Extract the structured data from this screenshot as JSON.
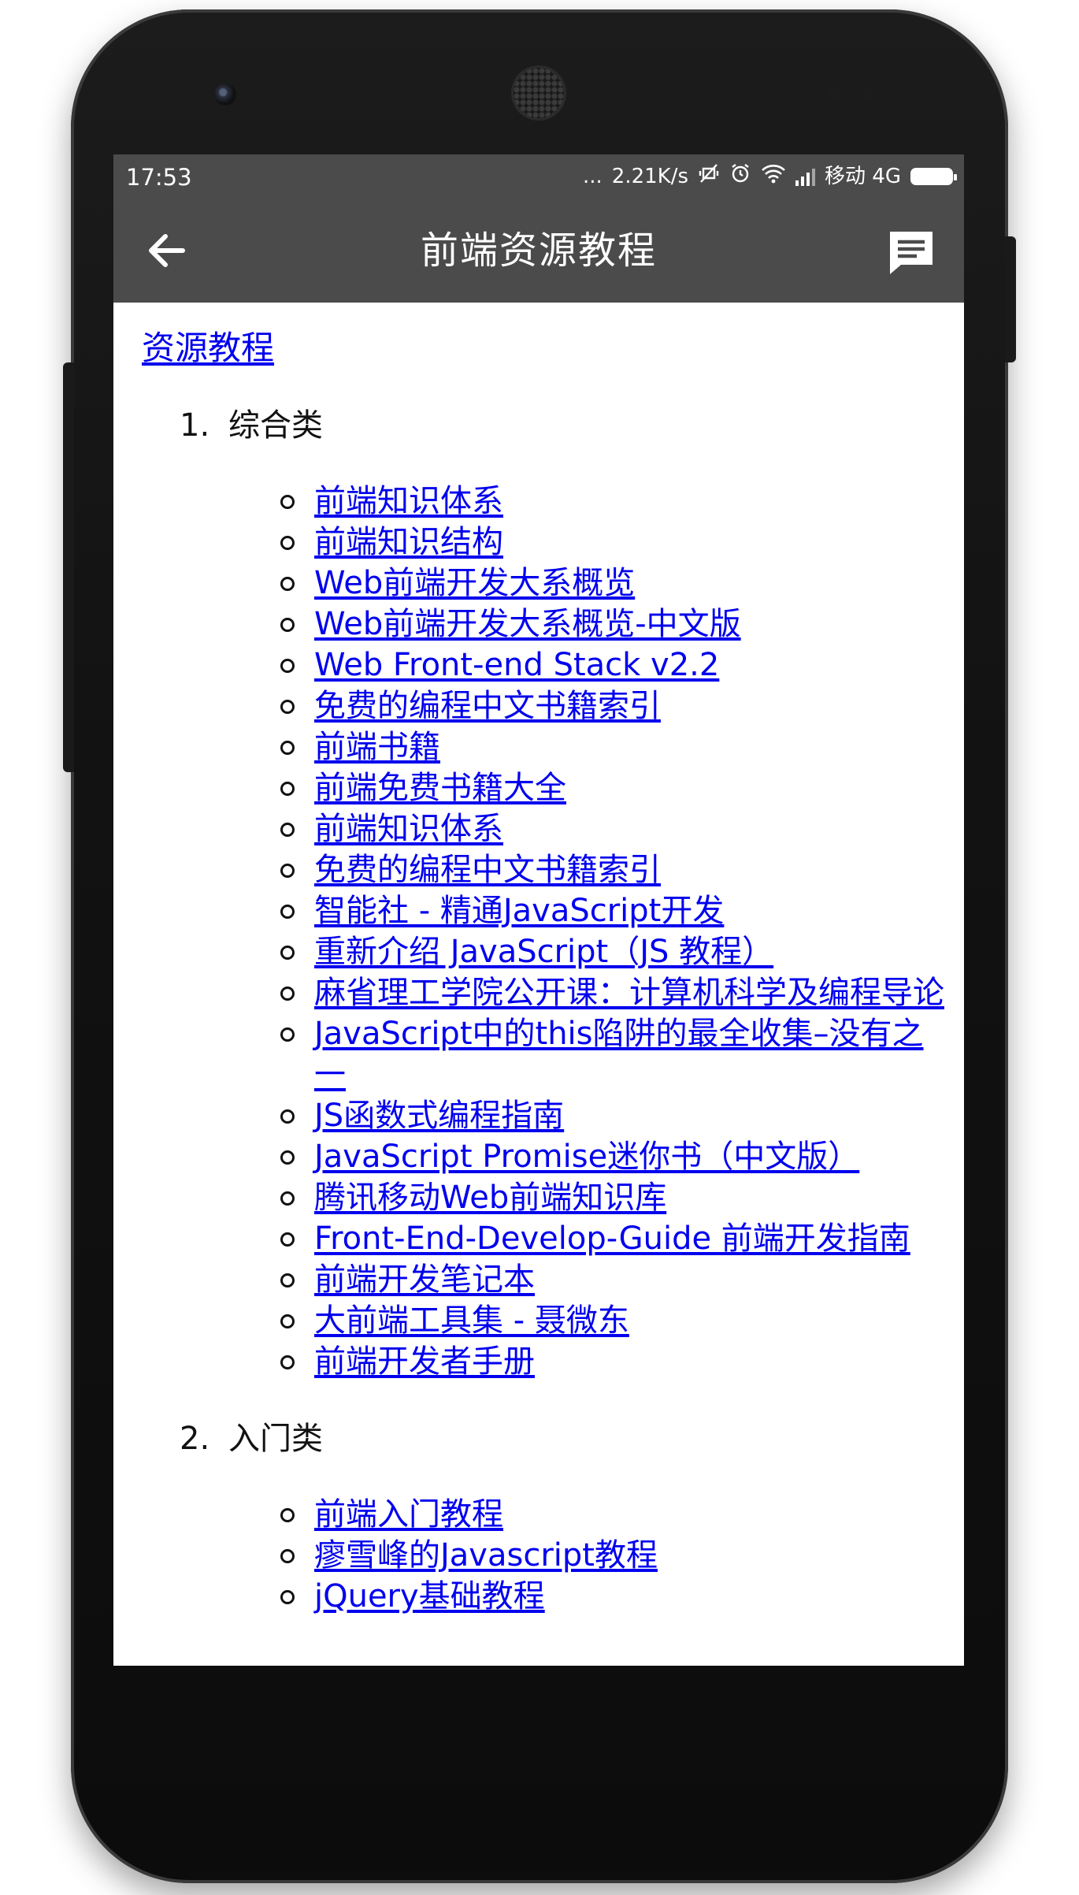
{
  "status_bar": {
    "time": "17:53",
    "dots": "...",
    "speed": "2.21K/s",
    "carrier": "移动 4G",
    "icons": [
      "vibrate-mute-icon",
      "alarm-icon",
      "wifi-icon",
      "signal-icon",
      "battery-icon"
    ]
  },
  "toolbar": {
    "title": "前端资源教程",
    "back_icon": "arrow-left-icon",
    "action_icon": "message-icon"
  },
  "content": {
    "top_link": "资源教程",
    "sections": [
      {
        "number": "1.",
        "title": "综合类",
        "items": [
          "前端知识体系",
          "前端知识结构",
          "Web前端开发大系概览",
          "Web前端开发大系概览-中文版",
          "Web Front-end Stack v2.2",
          "免费的编程中文书籍索引",
          "前端书籍",
          "前端免费书籍大全",
          "前端知识体系",
          "免费的编程中文书籍索引",
          "智能社 - 精通JavaScript开发",
          "重新介绍 JavaScript（JS 教程）",
          "麻省理工学院公开课：计算机科学及编程导论",
          "JavaScript中的this陷阱的最全收集–没有之一",
          "JS函数式编程指南",
          "JavaScript Promise迷你书（中文版）",
          "腾讯移动Web前端知识库",
          "Front-End-Develop-Guide 前端开发指南",
          "前端开发笔记本",
          "大前端工具集 - 聂微东",
          "前端开发者手册"
        ]
      },
      {
        "number": "2.",
        "title": "入门类",
        "items": [
          "前端入门教程",
          "瘳雪峰的Javascript教程",
          "jQuery基础教程"
        ]
      }
    ]
  }
}
